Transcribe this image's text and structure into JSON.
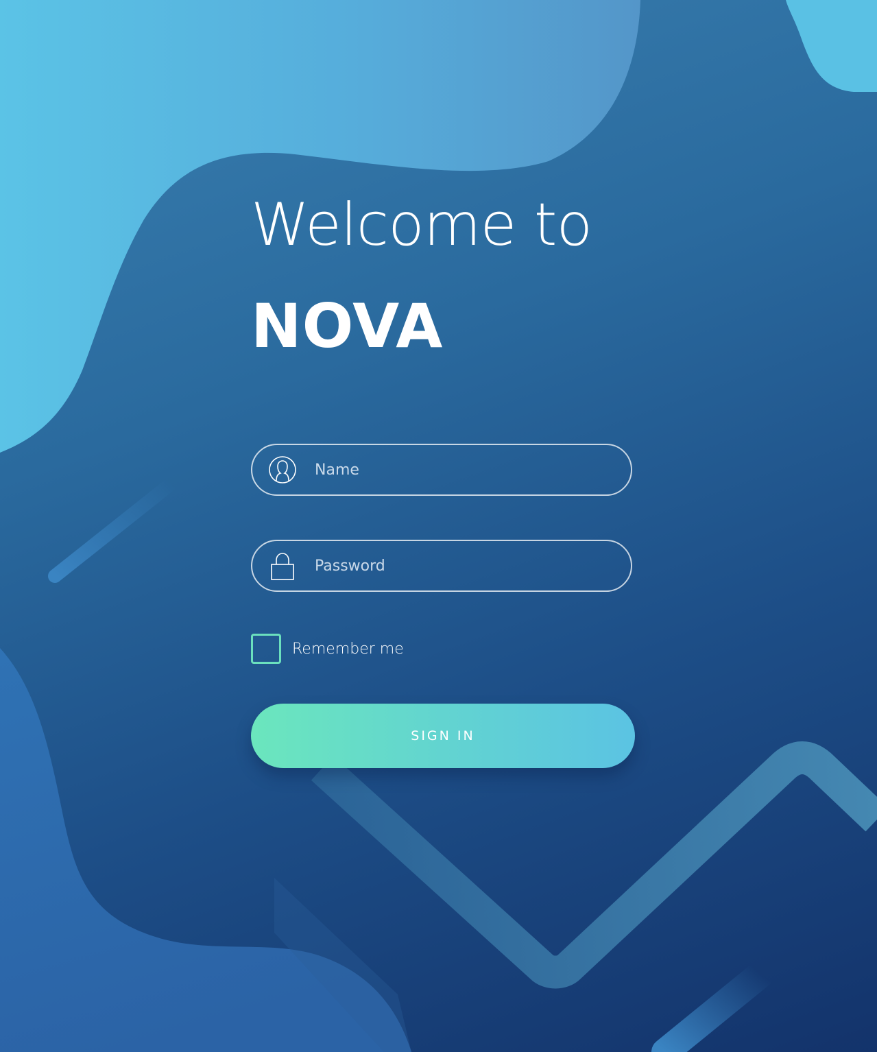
{
  "header": {
    "welcome_text": "Welcome to",
    "brand_name": "NOVA"
  },
  "form": {
    "name_placeholder": "Name",
    "password_placeholder": "Password",
    "remember_label": "Remember me",
    "remember_checked": false,
    "signin_label": "SIGN IN",
    "name_icon": "user-icon",
    "password_icon": "lock-icon"
  },
  "colors": {
    "accent_green": "#6be6bd",
    "accent_blue": "#5bc3e3",
    "background_dark": "#13336b",
    "background_light": "#5bc3e6"
  }
}
